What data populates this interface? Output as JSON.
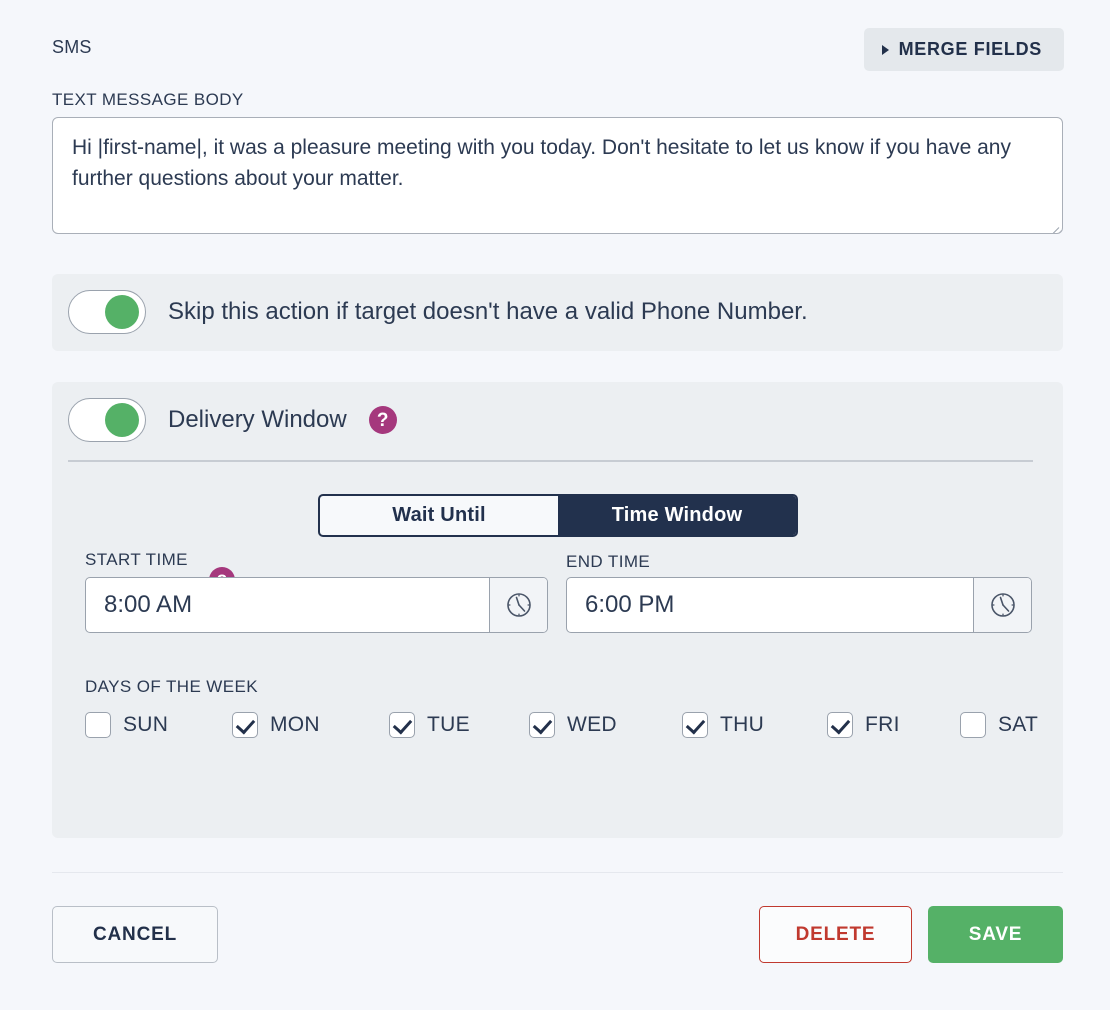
{
  "header": {
    "channel_label": "SMS",
    "merge_fields_label": "MERGE FIELDS",
    "merge_caret_icon": "caret-right-icon"
  },
  "message": {
    "label": "TEXT MESSAGE BODY",
    "value": "Hi |first-name|, it was a pleasure meeting with you today. Don't hesitate to let us know if you have any further questions about your matter.",
    "placeholder": "",
    "resize_handle_icon": "resize-grip-icon"
  },
  "skip_panel": {
    "toggle_state": "on",
    "label": "Skip this action if target doesn't have a valid Phone Number."
  },
  "delivery_panel": {
    "toggle_state": "on",
    "label": "Delivery Window",
    "help_icon": "question-mark-icon",
    "tabs": [
      {
        "label": "Wait Until",
        "active": false
      },
      {
        "label": "Time Window",
        "active": true
      }
    ],
    "start_time": {
      "label": "START TIME",
      "value": "8:00 AM",
      "help_icon": "question-mark-icon",
      "clock_icon": "clock-icon"
    },
    "end_time": {
      "label": "END TIME",
      "value": "6:00 PM",
      "clock_icon": "clock-icon"
    },
    "days_label": "DAYS OF THE WEEK",
    "days": [
      {
        "label": "SUN",
        "checked": false
      },
      {
        "label": "MON",
        "checked": true
      },
      {
        "label": "TUE",
        "checked": true
      },
      {
        "label": "WED",
        "checked": true
      },
      {
        "label": "THU",
        "checked": true
      },
      {
        "label": "FRI",
        "checked": true
      },
      {
        "label": "SAT",
        "checked": false
      }
    ]
  },
  "footer": {
    "cancel_label": "CANCEL",
    "delete_label": "DELETE",
    "save_label": "SAVE"
  },
  "colors": {
    "page_bg": "#f5f7fb",
    "panel_bg": "#eceff2",
    "navy": "#22314d",
    "green": "#55b167",
    "red": "#c0392f",
    "magenta": "#a5387d"
  }
}
